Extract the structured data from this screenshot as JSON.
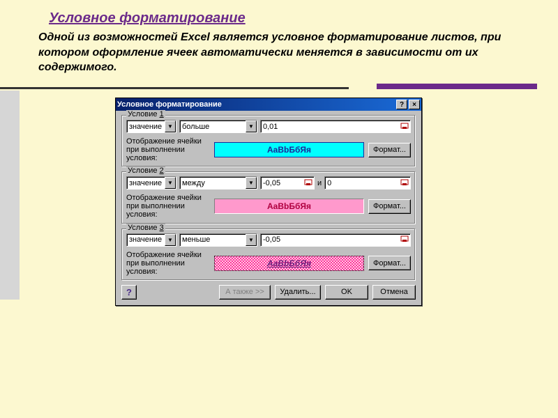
{
  "page": {
    "title": "Условное форматирование",
    "description": "Одной из возможностей Excel является условное форматирование листов, при котором оформление ячеек автоматически меняется в зависимости от их содержимого."
  },
  "dialog": {
    "title": "Условное форматирование",
    "help_glyph": "?",
    "close_glyph": "×",
    "display_label": "Отображение ячейки при выполнении условия:",
    "preview_sample": "AaBbБбЯя",
    "format_button": "Формат...",
    "and_label": "и",
    "conditions": [
      {
        "group_pre": "Условие ",
        "group_num": "1",
        "operand": "значение",
        "operator": "больше",
        "value1": "0,01"
      },
      {
        "group_pre": "Условие ",
        "group_num": "2",
        "operand": "значение",
        "operator": "между",
        "value1": "-0,05",
        "value2": "0"
      },
      {
        "group_pre": "Условие ",
        "group_num": "3",
        "operand": "значение",
        "operator": "меньше",
        "value1": "-0,05"
      }
    ],
    "buttons": {
      "also": "А также >>",
      "delete": "Удалить...",
      "ok": "OK",
      "cancel": "Отмена",
      "help": "?"
    }
  }
}
